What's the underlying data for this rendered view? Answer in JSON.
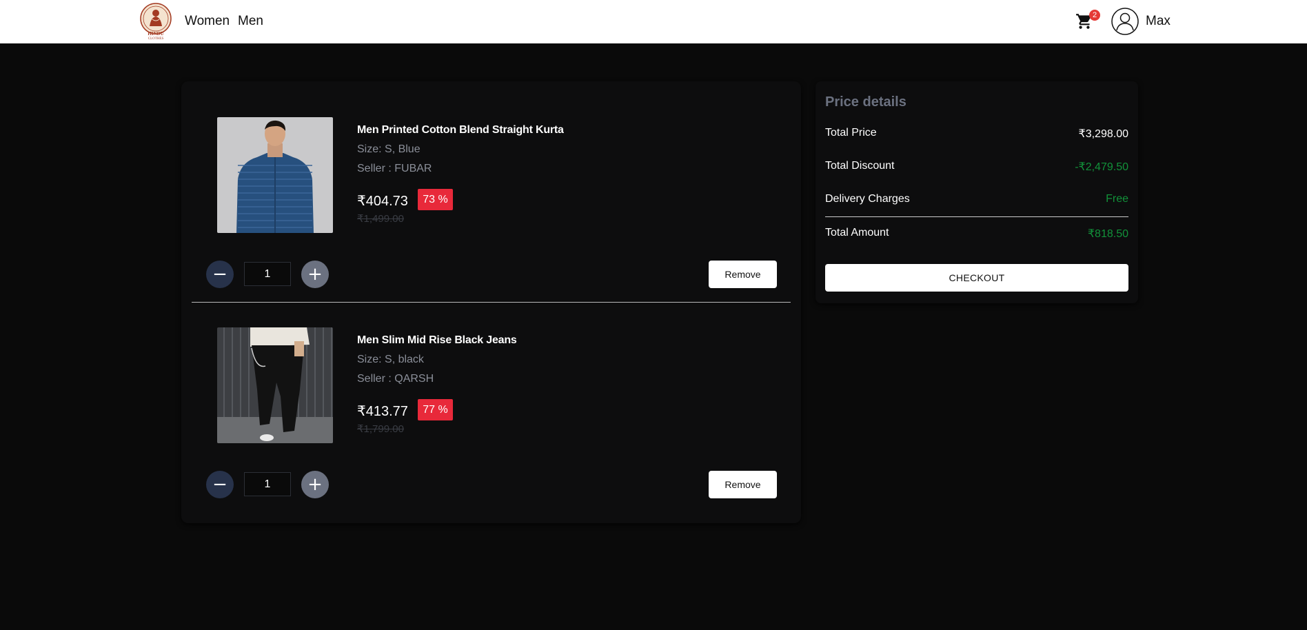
{
  "header": {
    "logo_alt": "HINDU CLOTHES",
    "nav": [
      {
        "label": "Women"
      },
      {
        "label": "Men"
      }
    ],
    "cart_count": "2",
    "username": "Max"
  },
  "cart": {
    "items": [
      {
        "title": "Men Printed Cotton Blend Straight Kurta",
        "size": "Size: S, Blue",
        "seller": "Seller : FUBAR",
        "price": "₹404.73",
        "discount": "73 %",
        "original_price": "₹1,499.00",
        "quantity": "1",
        "remove_label": "Remove"
      },
      {
        "title": "Men Slim Mid Rise Black Jeans",
        "size": "Size: S, black",
        "seller": "Seller : QARSH",
        "price": "₹413.77",
        "discount": "77 %",
        "original_price": "₹1,799.00",
        "quantity": "1",
        "remove_label": "Remove"
      }
    ]
  },
  "price_details": {
    "title": "Price details",
    "rows": [
      {
        "label": "Total Price",
        "value": "₹3,298.00"
      },
      {
        "label": "Total Discount",
        "value": "-₹2,479.50"
      },
      {
        "label": "Delivery Charges",
        "value": "Free"
      },
      {
        "label": "Total Amount",
        "value": "₹818.50"
      }
    ],
    "checkout_label": "CHECKOUT"
  },
  "colors": {
    "accent_red": "#e8293a",
    "green": "#12923a",
    "background": "#0a0a0a"
  }
}
